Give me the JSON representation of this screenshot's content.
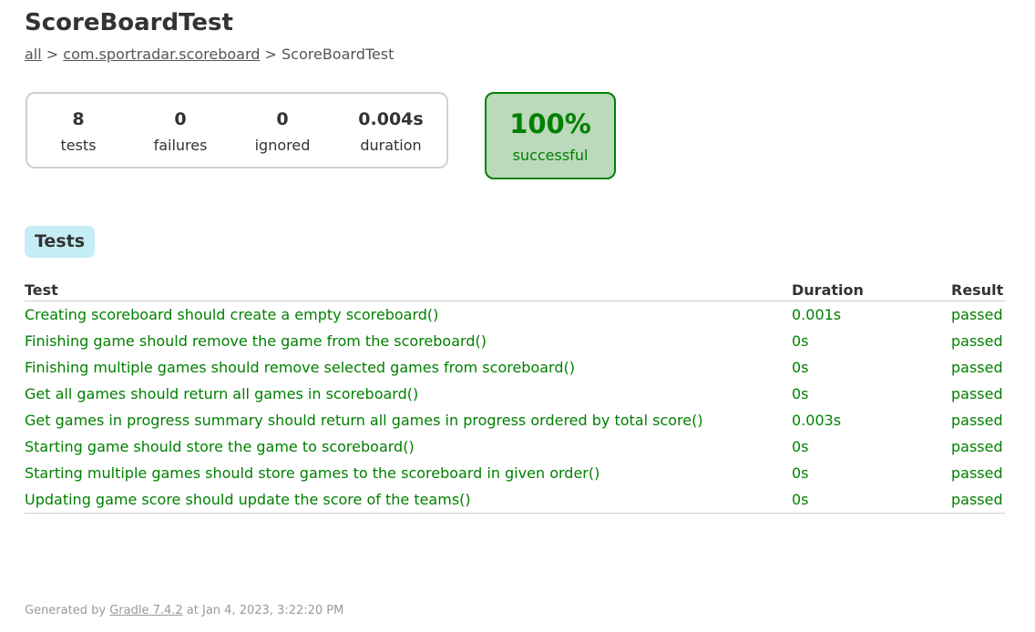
{
  "page": {
    "title": "ScoreBoardTest"
  },
  "breadcrumb": {
    "root": "all",
    "separator": ">",
    "package": "com.sportradar.scoreboard",
    "current": "ScoreBoardTest"
  },
  "summary": {
    "counters": [
      {
        "value": "8",
        "label": "tests"
      },
      {
        "value": "0",
        "label": "failures"
      },
      {
        "value": "0",
        "label": "ignored"
      },
      {
        "value": "0.004s",
        "label": "duration"
      }
    ],
    "success_rate": "100%",
    "success_label": "successful"
  },
  "tabs": {
    "tests_label": "Tests"
  },
  "table": {
    "headers": {
      "test": "Test",
      "duration": "Duration",
      "result": "Result"
    },
    "rows": [
      {
        "test": "Creating scoreboard should create a empty scoreboard()",
        "duration": "0.001s",
        "result": "passed"
      },
      {
        "test": "Finishing game should remove the game from the scoreboard()",
        "duration": "0s",
        "result": "passed"
      },
      {
        "test": "Finishing multiple games should remove selected games from scoreboard()",
        "duration": "0s",
        "result": "passed"
      },
      {
        "test": "Get all games should return all games in scoreboard()",
        "duration": "0s",
        "result": "passed"
      },
      {
        "test": "Get games in progress summary should return all games in progress ordered by total score()",
        "duration": "0.003s",
        "result": "passed"
      },
      {
        "test": "Starting game should store the game to scoreboard()",
        "duration": "0s",
        "result": "passed"
      },
      {
        "test": "Starting multiple games should store games to the scoreboard in given order()",
        "duration": "0s",
        "result": "passed"
      },
      {
        "test": "Updating game score should update the score of the teams()",
        "duration": "0s",
        "result": "passed"
      }
    ]
  },
  "footer": {
    "prefix": "Generated by",
    "link": "Gradle 7.4.2",
    "suffix": "at Jan 4, 2023, 3:22:20 PM"
  },
  "colors": {
    "success_green": "#008000",
    "success_bg": "#bbd9bb",
    "tab_bg": "#c5edf5",
    "border_gray": "#d0d0d0"
  }
}
